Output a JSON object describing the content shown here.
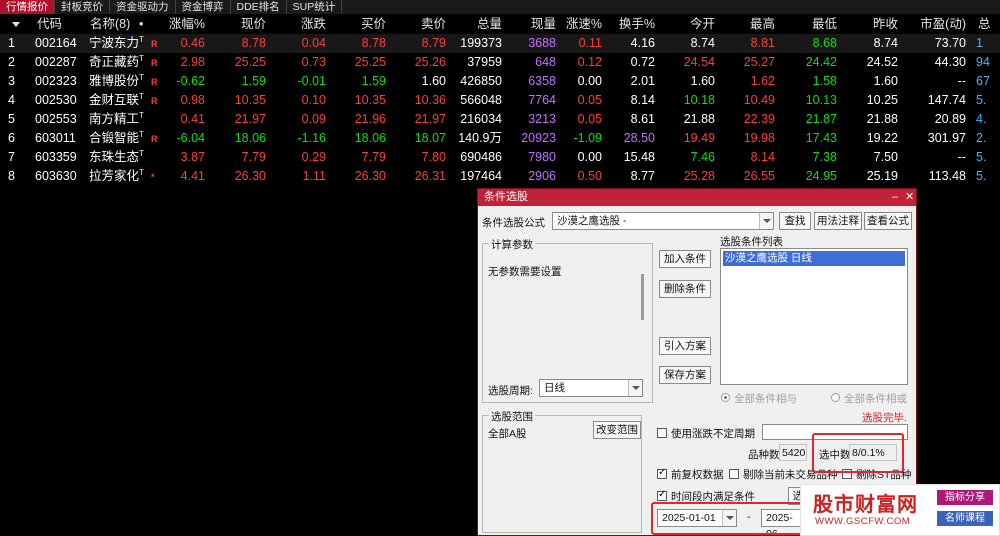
{
  "tabs": [
    "行情报价",
    "封板竞价",
    "资金驱动力",
    "资金博弈",
    "DDE排名",
    "SUP统计"
  ],
  "table": {
    "headers": [
      "代码",
      "名称(8)",
      "•",
      "涨幅%",
      "现价",
      "涨跌",
      "买价",
      "卖价",
      "总量",
      "现量",
      "涨速%",
      "换手%",
      "今开",
      "最高",
      "最低",
      "昨收",
      "市盈(动)",
      "总"
    ],
    "rows": [
      {
        "idx": "1",
        "code": "002164",
        "name": "宁波东力",
        "tag": "T",
        "r": "R",
        "chg_pct": "0.46",
        "price": "8.78",
        "chg": "0.04",
        "bid": "8.78",
        "ask": "8.79",
        "vol": "199373",
        "cur": "3688",
        "spd": "0.11",
        "turn": "4.16",
        "open": "8.74",
        "high": "8.81",
        "low": "8.68",
        "prev": "8.74",
        "pe": "73.70",
        "tot": "1"
      },
      {
        "idx": "2",
        "code": "002287",
        "name": "奇正藏药",
        "tag": "T",
        "r": "R",
        "chg_pct": "2.98",
        "price": "25.25",
        "chg": "0.73",
        "bid": "25.25",
        "ask": "25.26",
        "vol": "37959",
        "cur": "648",
        "spd": "0.12",
        "turn": "0.72",
        "open": "24.54",
        "high": "25.27",
        "low": "24.42",
        "prev": "24.52",
        "pe": "44.30",
        "tot": "94"
      },
      {
        "idx": "3",
        "code": "002323",
        "name": "雅博股份",
        "tag": "T",
        "r": "R",
        "chg_pct": "-0.62",
        "price": "1.59",
        "chg": "-0.01",
        "bid": "1.59",
        "ask": "1.60",
        "vol": "426850",
        "cur": "6358",
        "spd": "0.00",
        "turn": "2.01",
        "open": "1.60",
        "high": "1.62",
        "low": "1.58",
        "prev": "1.60",
        "pe": "--",
        "tot": "67"
      },
      {
        "idx": "4",
        "code": "002530",
        "name": "金财互联",
        "tag": "T",
        "r": "R",
        "chg_pct": "0.98",
        "price": "10.35",
        "chg": "0.10",
        "bid": "10.35",
        "ask": "10.36",
        "vol": "566048",
        "cur": "7764",
        "spd": "0.05",
        "turn": "8.14",
        "open": "10.18",
        "high": "10.49",
        "low": "10.13",
        "prev": "10.25",
        "pe": "147.74",
        "tot": "5."
      },
      {
        "idx": "5",
        "code": "002553",
        "name": "南方精工",
        "tag": "T",
        "r": "",
        "chg_pct": "0.41",
        "price": "21.97",
        "chg": "0.09",
        "bid": "21.96",
        "ask": "21.97",
        "vol": "216034",
        "cur": "3213",
        "spd": "0.05",
        "turn": "8.61",
        "open": "21.88",
        "high": "22.39",
        "low": "21.87",
        "prev": "21.88",
        "pe": "20.89",
        "tot": "4."
      },
      {
        "idx": "6",
        "code": "603011",
        "name": "合锻智能",
        "tag": "T",
        "r": "R",
        "chg_pct": "-6.04",
        "price": "18.06",
        "chg": "-1.16",
        "bid": "18.06",
        "ask": "18.07",
        "vol": "140.9万",
        "cur": "20923",
        "spd": "-1.09",
        "turn": "28.50",
        "open": "19.49",
        "high": "19.98",
        "low": "17.43",
        "prev": "19.22",
        "pe": "301.97",
        "tot": "2."
      },
      {
        "idx": "7",
        "code": "603359",
        "name": "东珠生态",
        "tag": "T",
        "r": "",
        "chg_pct": "3.87",
        "price": "7.79",
        "chg": "0.29",
        "bid": "7.79",
        "ask": "7.80",
        "vol": "690486",
        "cur": "7980",
        "spd": "0.00",
        "turn": "15.48",
        "open": "7.46",
        "high": "8.14",
        "low": "7.38",
        "prev": "7.50",
        "pe": "--",
        "tot": "5."
      },
      {
        "idx": "8",
        "code": "603630",
        "name": "拉芳家化",
        "tag": "T",
        "r": "*",
        "chg_pct": "4.41",
        "price": "26.30",
        "chg": "1.11",
        "bid": "26.30",
        "ask": "26.31",
        "vol": "197464",
        "cur": "2906",
        "spd": "0.50",
        "turn": "8.77",
        "open": "25.28",
        "high": "26.55",
        "low": "24.95",
        "prev": "25.19",
        "pe": "113.48",
        "tot": "5."
      }
    ]
  },
  "dialog": {
    "title": "条件选股",
    "formula_label": "条件选股公式",
    "formula_value": "沙漠之鹰选股  -",
    "btn_find": "查找",
    "btn_usage": "用法注释",
    "btn_view": "查看公式",
    "params_title": "计算参数",
    "params_text": "无参数需要设置",
    "btn_add": "加入条件",
    "btn_delete": "删除条件",
    "btn_import": "引入方案",
    "btn_save": "保存方案",
    "list_title": "选股条件列表",
    "list_items": [
      "沙漠之鹰选股  日线"
    ],
    "period_label": "选股周期:",
    "period_value": "日线",
    "radio_and": "全部条件相与",
    "radio_or": "全部条件相或",
    "status": "选股完毕.",
    "range_title": "选股范围",
    "range_value": "全部A股",
    "btn_change_range": "改变范围",
    "chk_uncertain": "使用涨跌不定周期",
    "count_label": "品种数",
    "count_value": "5420",
    "selected_label": "选中数",
    "selected_value": "8/0.1%",
    "chk_restore": "前复权数据",
    "chk_remove_untraded": "剔除当前未交易品种",
    "chk_remove_st": "剔除ST品种",
    "chk_timerange": "时间段内满足条件",
    "btn_partial": "选",
    "date_from": "2025-01-01",
    "date_sep": "-",
    "date_to": "2025-06"
  },
  "watermark": {
    "main": "股市财富网",
    "url": "WWW.GSCFW.COM",
    "badge1": "指标分享",
    "badge2": "名师课程"
  },
  "colors": {
    "up": "#ff3b3b",
    "down": "#00e600",
    "accent": "#c0223a"
  }
}
